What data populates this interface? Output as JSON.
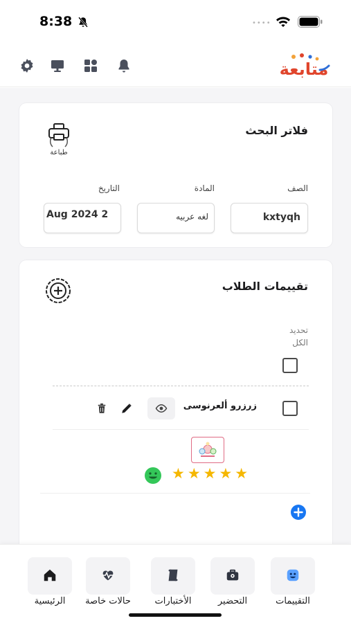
{
  "status_bar": {
    "time": "8:38",
    "signal_dots": "••••"
  },
  "header": {
    "brand_logo_text": "متابعة",
    "icons": [
      "gear-icon",
      "monitor-icon",
      "grid-icon",
      "bell-icon"
    ]
  },
  "filters": {
    "title": "فلاتر البحث",
    "print_label": "طباعة",
    "fields": {
      "class": {
        "label": "الصف",
        "value": "kxtyqh"
      },
      "subject": {
        "label": "المادة",
        "value": "لغه عربيه"
      },
      "date": {
        "label": "التاريخ",
        "value": "Aug 2024 2"
      }
    }
  },
  "evaluations": {
    "title": "تقييمات الطلاب",
    "select_all_label": "تحديد الكل",
    "student": {
      "name": "زرزرو ألعرنوسى",
      "rating": 5,
      "stars": "★★★★★"
    }
  },
  "bottom_nav": {
    "items": [
      {
        "label": "الرئيسية",
        "icon": "home-icon"
      },
      {
        "label": "حالات خاصة",
        "icon": "heartbeat-icon"
      },
      {
        "label": "الأختبارات",
        "icon": "scroll-icon"
      },
      {
        "label": "التحضير",
        "icon": "briefcase-icon"
      },
      {
        "label": "التقييمات",
        "icon": "smiley-icon"
      }
    ]
  },
  "colors": {
    "accent_blue": "#1877f2",
    "star": "#f5b700",
    "smile_green": "#34c759",
    "logo_red": "#e0452c",
    "logo_blue": "#2f6fd8",
    "logo_orange": "#f2a23a"
  }
}
